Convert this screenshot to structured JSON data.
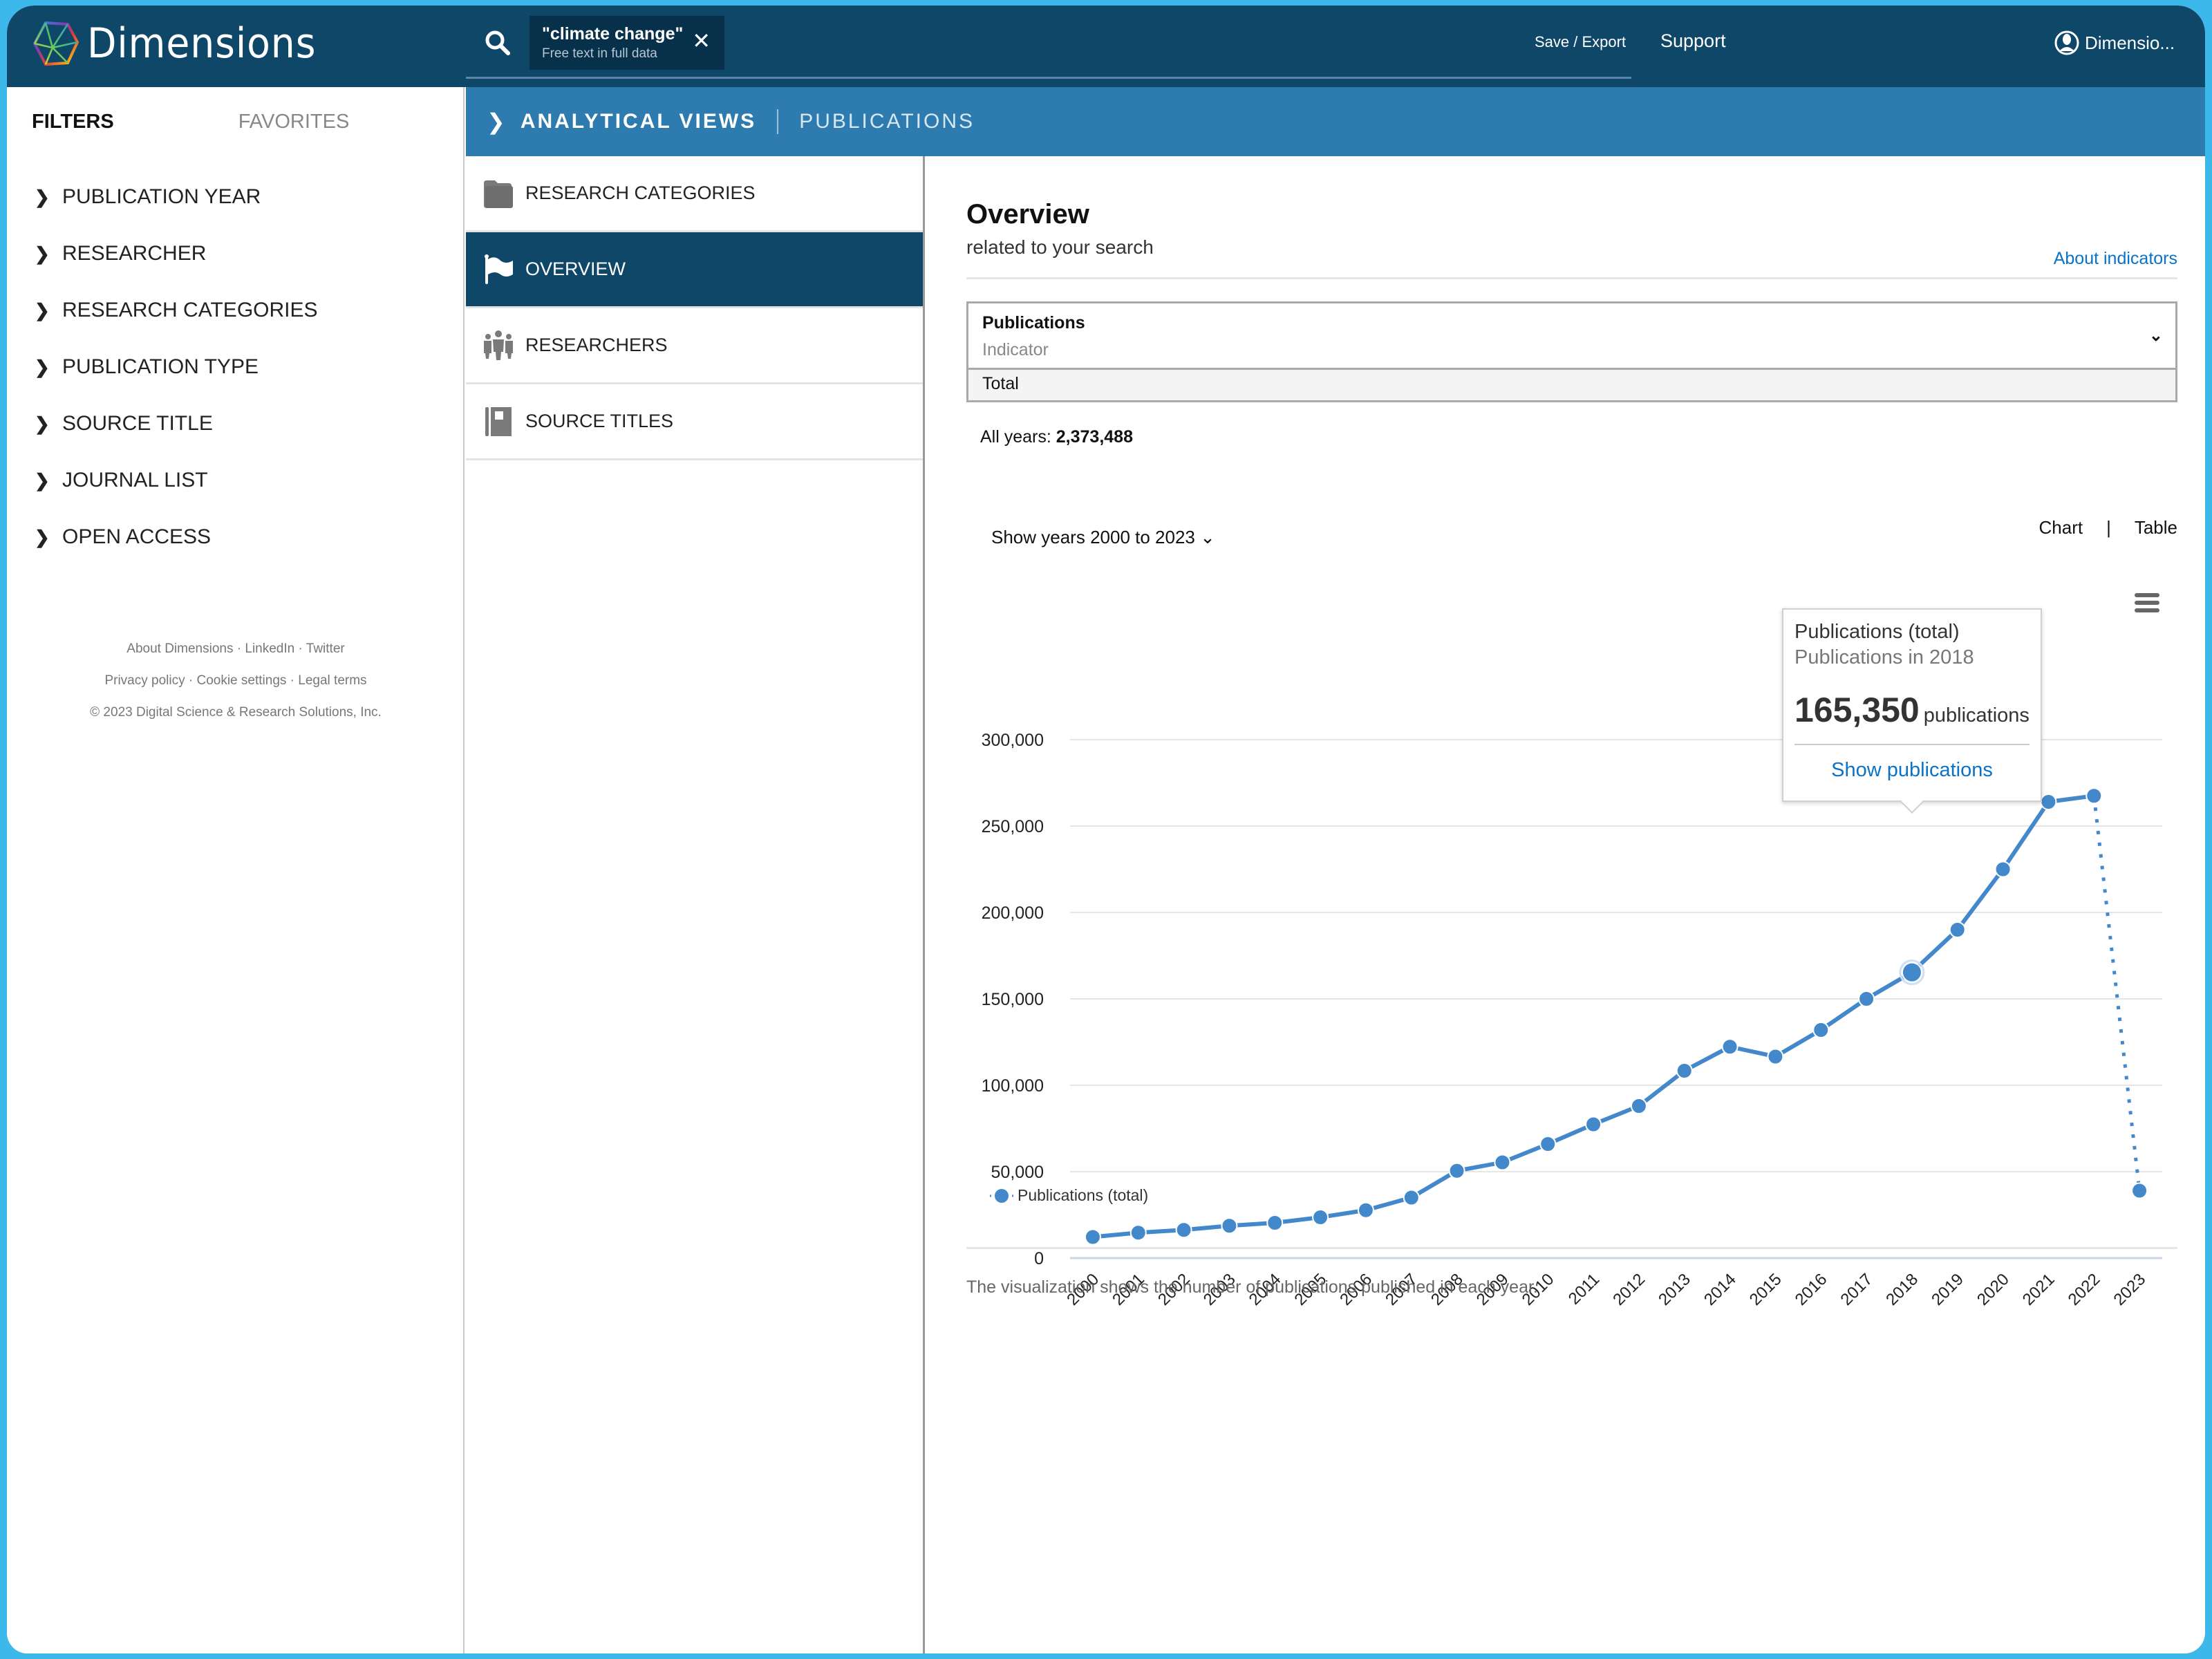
{
  "app": {
    "name": "Dimensions"
  },
  "header": {
    "search": {
      "query": "\"climate change\"",
      "scope": "Free text in full data",
      "close_icon": "close-icon"
    },
    "save_export": "Save / Export",
    "support": "Support",
    "user": "Dimensio..."
  },
  "filters": {
    "tabs": {
      "filters": "FILTERS",
      "favorites": "FAVORITES"
    },
    "items": [
      {
        "label": "PUBLICATION YEAR"
      },
      {
        "label": "RESEARCHER"
      },
      {
        "label": "RESEARCH CATEGORIES"
      },
      {
        "label": "PUBLICATION TYPE"
      },
      {
        "label": "SOURCE TITLE"
      },
      {
        "label": "JOURNAL LIST"
      },
      {
        "label": "OPEN ACCESS"
      }
    ],
    "footer": {
      "about": "About Dimensions",
      "linkedin": "LinkedIn",
      "twitter": "Twitter",
      "privacy": "Privacy policy",
      "cookies": "Cookie settings",
      "legal": "Legal terms",
      "dot": " · ",
      "copyright": "© 2023 Digital Science & Research Solutions, Inc."
    }
  },
  "breadcrumb": {
    "main": "ANALYTICAL VIEWS",
    "sub": "PUBLICATIONS"
  },
  "views": [
    {
      "label": "RESEARCH CATEGORIES",
      "icon": "folder-icon",
      "active": false
    },
    {
      "label": "OVERVIEW",
      "icon": "flag-icon",
      "active": true
    },
    {
      "label": "RESEARCHERS",
      "icon": "people-icon",
      "active": false
    },
    {
      "label": "SOURCE TITLES",
      "icon": "book-icon",
      "active": false
    }
  ],
  "overview": {
    "title": "Overview",
    "subtitle": "related to your search",
    "about_indicators": "About indicators",
    "indicator": {
      "title": "Publications",
      "subtitle": "Indicator",
      "option": "Total"
    },
    "all_years_label": "All years:",
    "all_years_value": "2,373,488",
    "show_years": "Show years 2000 to 2023",
    "view_chart": "Chart",
    "view_sep": "|",
    "view_table": "Table",
    "note": "The visualization shows the number of publications published in each year."
  },
  "tooltip": {
    "series": "Publications (total)",
    "year_label": "Publications in 2018",
    "value": "165,350",
    "unit": "publications",
    "link": "Show publications"
  },
  "colors": {
    "series": "#4488cc",
    "header": "#0f4769",
    "breadcrumb": "#2d7baf",
    "link": "#0a73c7"
  },
  "chart_data": {
    "type": "line",
    "title": "",
    "xlabel": "",
    "ylabel": "",
    "x": [
      "2000",
      "2001",
      "2002",
      "2003",
      "2004",
      "2005",
      "2006",
      "2007",
      "2008",
      "2009",
      "2010",
      "2011",
      "2012",
      "2013",
      "2014",
      "2015",
      "2016",
      "2017",
      "2018",
      "2019",
      "2020",
      "2021",
      "2022",
      "2023"
    ],
    "series": [
      {
        "name": "Publications (total)",
        "values": [
          12200,
          14700,
          16300,
          18700,
          20400,
          23600,
          27700,
          35000,
          50500,
          55400,
          66000,
          77400,
          88000,
          108400,
          122300,
          116600,
          132000,
          150000,
          165350,
          190000,
          225000,
          264000,
          267500,
          39000
        ],
        "dashed_last_segment": true
      }
    ],
    "ylim": [
      0,
      300000
    ],
    "yticks": [
      0,
      50000,
      100000,
      150000,
      200000,
      250000,
      300000
    ],
    "ytick_labels": [
      "0",
      "50,000",
      "100,000",
      "150,000",
      "200,000",
      "250,000",
      "300,000"
    ],
    "grid": true,
    "legend": "bottom-left",
    "highlighted_point": "2018"
  }
}
